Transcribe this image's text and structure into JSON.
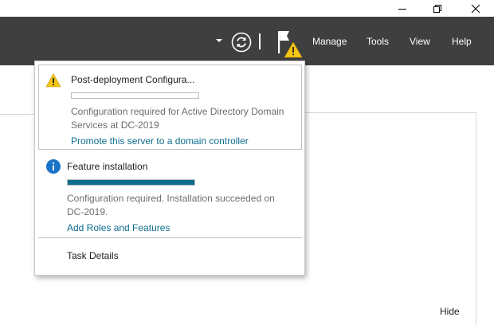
{
  "window": {
    "minimize_icon": "minimize-icon",
    "maximize_icon": "restore-icon",
    "close_icon": "close-icon"
  },
  "menubar": {
    "items": [
      "Manage",
      "Tools",
      "View",
      "Help"
    ],
    "refresh_icon": "refresh-icon",
    "notifications_icon": "notification-flag-warning-icon"
  },
  "notifications": {
    "tasks": [
      {
        "icon": "warning-icon",
        "title": "Post-deployment Configura...",
        "progress": 0,
        "description": "Configuration required for Active Directory Domain Services at DC-2019",
        "link": "Promote this server to a domain controller"
      },
      {
        "icon": "info-icon",
        "title": "Feature installation",
        "progress": 1,
        "description": "Configuration required. Installation succeeded on DC-2019.",
        "link": "Add Roles and Features"
      }
    ],
    "task_details": "Task Details"
  },
  "main": {
    "hide_label": "Hide"
  },
  "colors": {
    "menubar_bg": "#3f3f3f",
    "accent": "#0e6d8e",
    "warning": "#f5c518"
  }
}
